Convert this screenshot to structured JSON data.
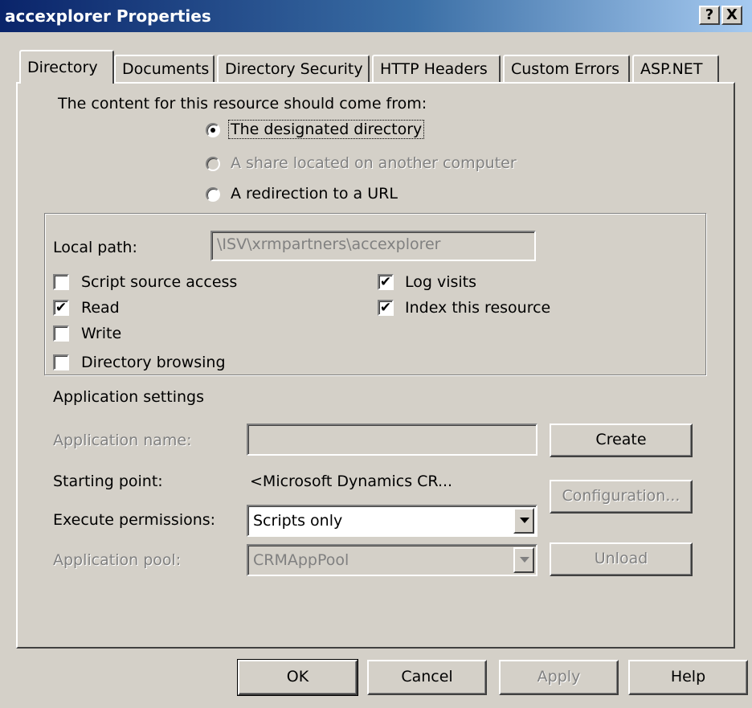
{
  "window": {
    "title": "accexplorer Properties",
    "help_btn": "?",
    "close_btn": "X"
  },
  "tabs": [
    {
      "label": "Directory",
      "active": true
    },
    {
      "label": "Documents"
    },
    {
      "label": "Directory Security"
    },
    {
      "label": "HTTP Headers"
    },
    {
      "label": "Custom Errors"
    },
    {
      "label": "ASP.NET"
    }
  ],
  "content_source": {
    "heading": "The content for this resource should come from:",
    "options": [
      {
        "label": "The designated directory",
        "selected": true,
        "enabled": true
      },
      {
        "label": "A share located on another computer",
        "selected": false,
        "enabled": false
      },
      {
        "label": "A redirection to a URL",
        "selected": false,
        "enabled": true
      }
    ]
  },
  "local_path": {
    "label": "Local path:",
    "value": "\\ISV\\xrmpartners\\accexplorer"
  },
  "checkboxes": [
    {
      "label": "Script source access",
      "checked": false
    },
    {
      "label": "Read",
      "checked": true
    },
    {
      "label": "Write",
      "checked": false
    },
    {
      "label": "Directory browsing",
      "checked": false
    },
    {
      "label": "Log visits",
      "checked": true
    },
    {
      "label": "Index this resource",
      "checked": true
    }
  ],
  "app_settings": {
    "heading": "Application settings",
    "app_name_label": "Application name:",
    "app_name_value": "",
    "create_btn": "Create",
    "starting_point_label": "Starting point:",
    "starting_point_value": "<Microsoft Dynamics CR...",
    "configuration_btn": "Configuration...",
    "execute_label": "Execute permissions:",
    "execute_value": "Scripts only",
    "app_pool_label": "Application pool:",
    "app_pool_value": "CRMAppPool",
    "unload_btn": "Unload"
  },
  "footer": {
    "ok": "OK",
    "cancel": "Cancel",
    "apply": "Apply",
    "help": "Help"
  },
  "check_glyph": "✔"
}
